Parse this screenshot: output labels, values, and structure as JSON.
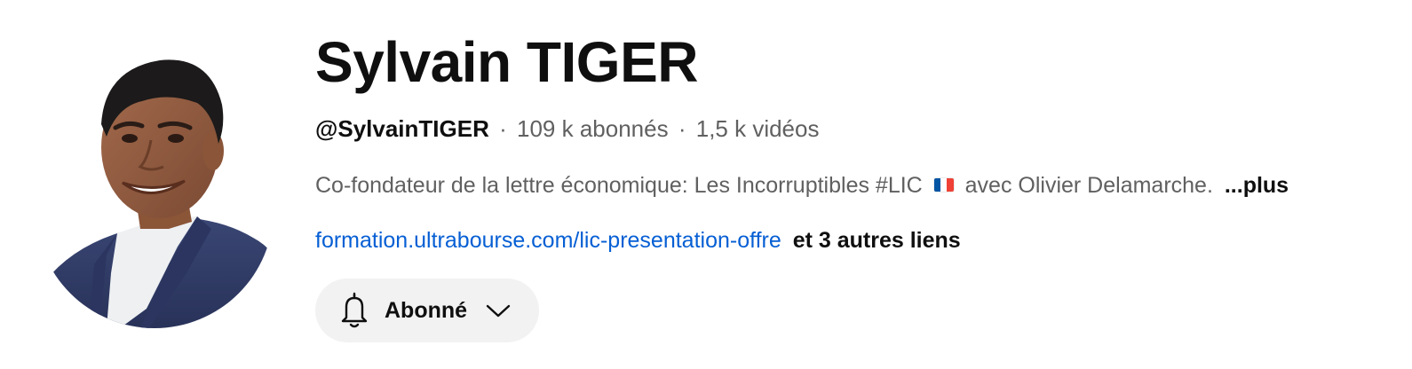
{
  "channel": {
    "name": "Sylvain TIGER",
    "handle": "@SylvainTIGER",
    "subscribers": "109 k abonnés",
    "videos": "1,5 k vidéos",
    "separator": "·",
    "description_before_flag": "Co-fondateur de la lettre économique: Les Incorruptibles #LIC",
    "description_after_flag": "avec Olivier Delamarche.",
    "more_label": "...plus",
    "primary_link": "formation.ultrabourse.com/lic-presentation-offre",
    "other_links_label": "et 3 autres liens"
  },
  "subscribe_button": {
    "label": "Abonné",
    "icon": "bell-icon",
    "dropdown_icon": "chevron-down-icon"
  },
  "icons": {
    "avatar": "channel-avatar",
    "flag": "france-flag-icon"
  },
  "colors": {
    "link": "#065fd4",
    "secondary_text": "#606060",
    "button_bg": "#f2f2f2",
    "flag_blue": "#0055a4",
    "flag_white": "#ffffff",
    "flag_red": "#ef4135"
  }
}
